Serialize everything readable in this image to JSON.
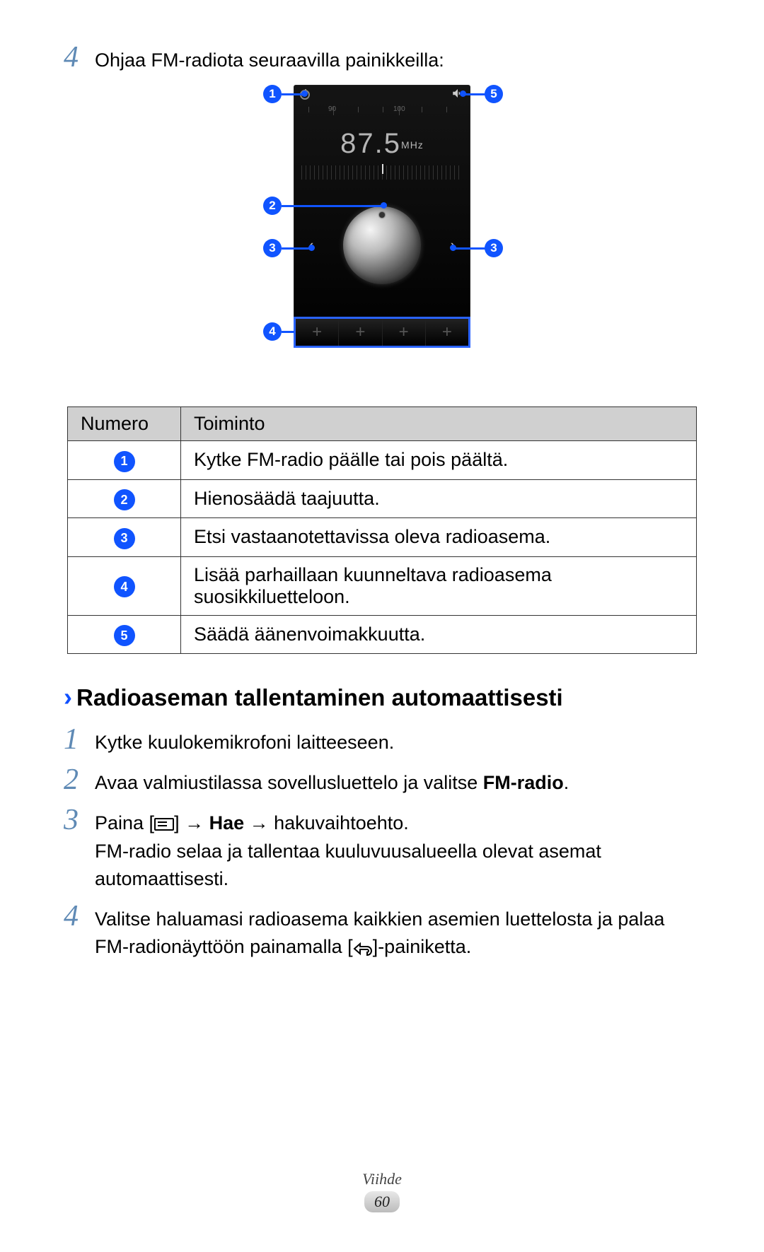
{
  "intro_step": {
    "num": "4",
    "text": "Ohjaa FM-radiota seuraavilla painikkeilla:"
  },
  "radio": {
    "frequency": "87.5",
    "unit": "MHz",
    "scale": {
      "label_90": "90",
      "label_100": "100"
    },
    "prev": "‹",
    "next": "›",
    "add": "+"
  },
  "callouts": {
    "c1": "1",
    "c2": "2",
    "c3": "3",
    "c4": "4",
    "c5": "5"
  },
  "table": {
    "h1": "Numero",
    "h2": "Toiminto",
    "rows": [
      {
        "n": "1",
        "t": "Kytke FM-radio päälle tai pois päältä."
      },
      {
        "n": "2",
        "t": "Hienosäädä taajuutta."
      },
      {
        "n": "3",
        "t": "Etsi vastaanotettavissa oleva radioasema."
      },
      {
        "n": "4",
        "t": "Lisää parhaillaan kuunneltava radioasema suosikkiluetteloon."
      },
      {
        "n": "5",
        "t": "Säädä äänenvoimakkuutta."
      }
    ]
  },
  "section": {
    "chev": "›",
    "title": "Radioaseman tallentaminen automaattisesti"
  },
  "steps": {
    "s1": {
      "n": "1",
      "t": "Kytke kuulokemikrofoni laitteeseen."
    },
    "s2": {
      "n": "2",
      "pre": "Avaa valmiustilassa sovellusluettelo ja valitse ",
      "bold": "FM-radio",
      "post": "."
    },
    "s3": {
      "n": "3",
      "l1_pre": "Paina [",
      "l1_mid1": "] → ",
      "l1_bold": "Hae",
      "l1_mid2": " → hakuvaihtoehto.",
      "l2": "FM-radio selaa ja tallentaa kuuluvuusalueella olevat asemat automaattisesti."
    },
    "s4": {
      "n": "4",
      "pre": "Valitse haluamasi radioasema kaikkien asemien luettelosta ja palaa FM-radionäyttöön painamalla [",
      "post": "]-painiketta."
    }
  },
  "footer": {
    "cat": "Viihde",
    "page": "60"
  }
}
